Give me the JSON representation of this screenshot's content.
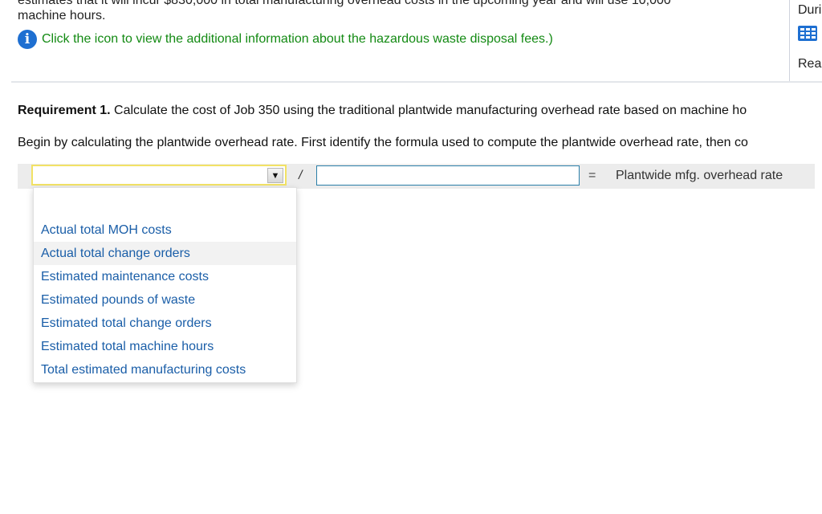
{
  "problem": {
    "clipped_line": "estimates that it will incur $830,000 in total manufacturing overhead costs in the upcoming year and will use 10,000",
    "line2": "machine hours.",
    "info_text": "Click the icon to view the additional information about the hazardous waste disposal fees.)",
    "info_icon": "info-icon"
  },
  "right_panel": {
    "text1": "Duri",
    "icon": "table-grid-icon",
    "text2": "Rea"
  },
  "requirement": {
    "bold": "Requirement 1.",
    "text": " Calculate the cost of Job 350 using the traditional plantwide manufacturing overhead rate based on machine ho"
  },
  "instruction": "Begin by calculating the plantwide overhead rate. First identify the formula used to compute the plantwide overhead rate, then co",
  "formula": {
    "select_value": "",
    "arrow_glyph": "▼",
    "operator": "/",
    "input_value": "",
    "equals": "=",
    "result_label": "Plantwide mfg. overhead rate"
  },
  "dropdown": {
    "options": [
      "Actual total MOH costs",
      "Actual total change orders",
      "Estimated maintenance costs",
      "Estimated pounds of waste",
      "Estimated total change orders",
      "Estimated total machine hours",
      "Total estimated manufacturing costs"
    ],
    "hovered_index": 1
  }
}
